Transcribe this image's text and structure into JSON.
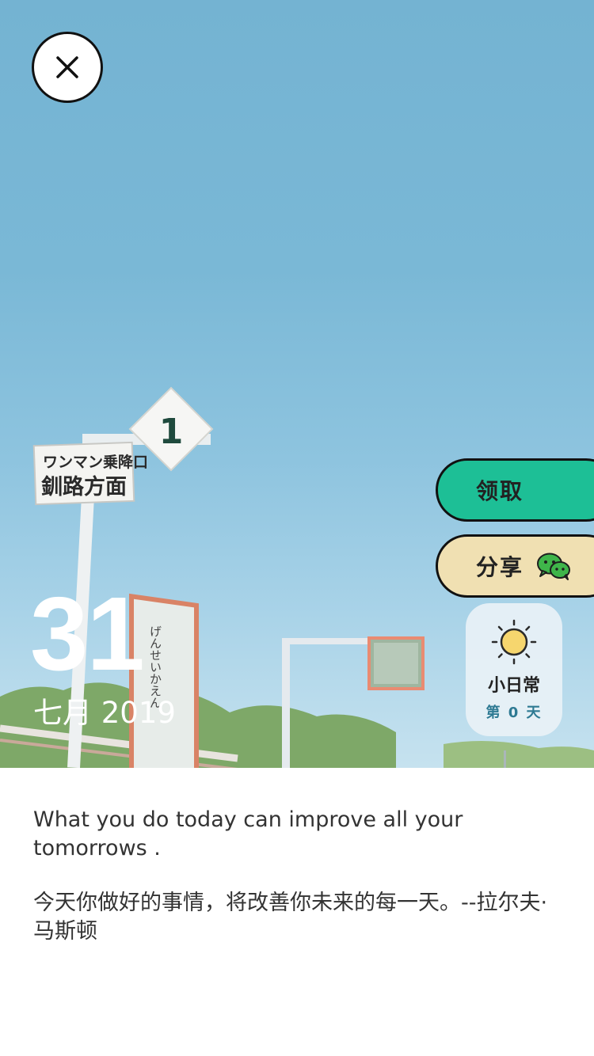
{
  "date": {
    "day": "31",
    "month_year": "七月 2019"
  },
  "actions": {
    "get_label": "领取",
    "share_label": "分享"
  },
  "daily": {
    "title": "小日常",
    "count": "第 0 天"
  },
  "photo": {
    "sign_station": [
      "ワンマン乗降口",
      "釧路方面"
    ],
    "diamond_number": "1",
    "board_text": "げんせいかえん"
  },
  "quote": {
    "english": "What you do today can improve all your tomorrows .",
    "chinese": "今天你做好的事情，将改善你未来的每一天。--拉尔夫·马斯顿"
  },
  "icons": {
    "close": "close-icon",
    "wechat": "wechat-icon",
    "sun": "sun-icon"
  },
  "colors": {
    "get_button": "#1dbf96",
    "share_button": "#f0e0b2",
    "sky": "#74b3d2"
  }
}
